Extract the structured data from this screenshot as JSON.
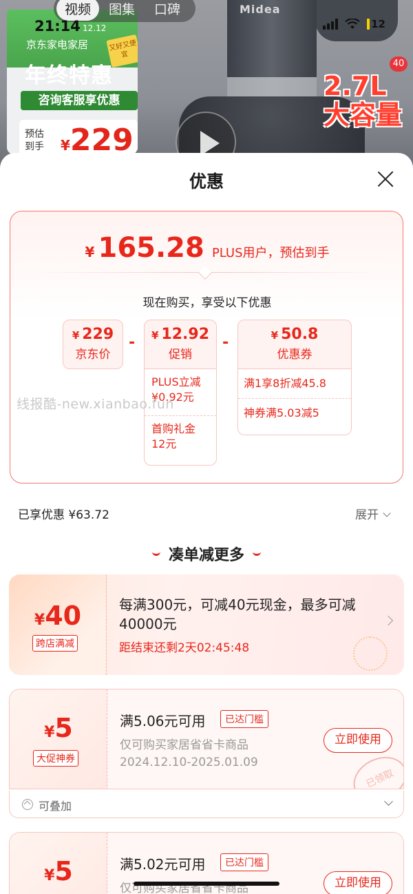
{
  "status_bar": {
    "time": "21:14",
    "battery": "12"
  },
  "media_tabs": [
    "视频",
    "图集",
    "口碑"
  ],
  "banner": {
    "brand": "Midea",
    "promo_year": "12.12",
    "promo_line": "京东家电家居",
    "promo_title": "年终特惠",
    "promo_badge": "又好又便宜",
    "promo_sub": "咨询客服享优惠",
    "price_label": "预估到手",
    "price_currency": "¥",
    "price": "229",
    "capacity": "2.7L\n大容量",
    "count_badge": "40"
  },
  "sheet": {
    "title": "优惠",
    "final_currency": "¥",
    "final_amount": "165.28",
    "final_desc": "PLUS用户，预估到手",
    "enjoy_line": "现在购买，享受以下优惠",
    "breakdown": [
      {
        "currency": "¥",
        "value": "229",
        "label": "京东价"
      },
      {
        "currency": "¥",
        "value": "12.92",
        "label": "促销"
      },
      {
        "currency": "¥",
        "value": "50.8",
        "label": "优惠券"
      }
    ],
    "operator": "-",
    "promo_items": [
      "PLUS立减¥0.92元",
      "首购礼金12元"
    ],
    "coupon_items": [
      "满1享8折减45.8",
      "神券满5.03减5"
    ],
    "watermark": "线报酷-new.xianbao.fun",
    "enjoyed": "已享优惠 ¥63.72",
    "expand": "展开"
  },
  "more_section": {
    "title": "凑单减更多",
    "cross_store": {
      "currency": "¥",
      "amount": "40",
      "tag": "跨店满减",
      "text": "每满300元，可减40元现金，最多可减40000元",
      "countdown": "距结束还剩2天02:45:48"
    },
    "coupons": [
      {
        "currency": "¥",
        "amount": "5",
        "tag": "大促神券",
        "title": "满5.06元可用",
        "status": "已达门槛",
        "desc": "仅可购买家居省省卡商品",
        "date": "2024.12.10-2025.01.09",
        "button": "立即使用",
        "stamp": "已领取"
      },
      {
        "currency": "¥",
        "amount": "5",
        "tag": "",
        "title": "满5.02元可用",
        "status": "已达门槛",
        "desc": "仅可购买家居省省卡商品",
        "date": "",
        "button": "立即使用"
      }
    ],
    "stack_label": "可叠加"
  },
  "colors": {
    "accent": "#e7271b",
    "border": "#f3786c"
  }
}
